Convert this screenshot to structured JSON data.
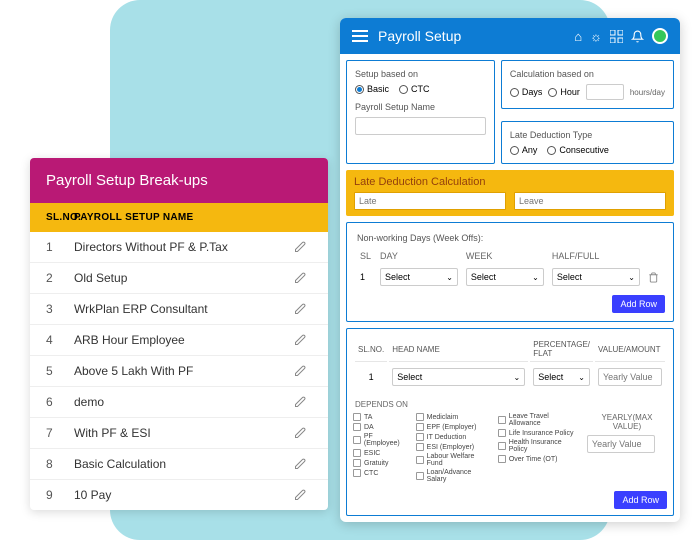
{
  "left": {
    "title": "Payroll Setup Break-ups",
    "cols": {
      "sl": "SL.NO.",
      "name": "PAYROLL SETUP NAME"
    },
    "rows": [
      {
        "n": "1",
        "name": "Directors Without PF & P.Tax"
      },
      {
        "n": "2",
        "name": "Old Setup"
      },
      {
        "n": "3",
        "name": "WrkPlan ERP Consultant"
      },
      {
        "n": "4",
        "name": "ARB Hour Employee"
      },
      {
        "n": "5",
        "name": "Above 5 Lakh With PF"
      },
      {
        "n": "6",
        "name": "demo"
      },
      {
        "n": "7",
        "name": "With PF & ESI"
      },
      {
        "n": "8",
        "name": "Basic Calculation"
      },
      {
        "n": "9",
        "name": "10 Pay"
      }
    ]
  },
  "right": {
    "title": "Payroll Setup",
    "setup": {
      "legend": "Setup based on",
      "opt1": "Basic",
      "opt2": "CTC",
      "name_label": "Payroll Setup Name"
    },
    "calc": {
      "legend": "Calculation based on",
      "opt1": "Days",
      "opt2": "Hour",
      "unit": "hours/day"
    },
    "late_type": {
      "legend": "Late Deduction Type",
      "opt1": "Any",
      "opt2": "Consecutive"
    },
    "late_calc": {
      "title": "Late Deduction Calculation",
      "ph1": "Late",
      "ph2": "Leave"
    },
    "nwd": {
      "title": "Non-working Days (Week Offs):",
      "cols": {
        "sl": "SL",
        "day": "DAY",
        "week": "WEEK",
        "hf": "HALF/FULL"
      },
      "row": {
        "n": "1",
        "sel": "Select"
      },
      "add": "Add Row"
    },
    "heads": {
      "cols": {
        "sl": "SL.NO.",
        "name": "HEAD NAME",
        "pf": "PERCENTAGE/\nFLAT",
        "va": "VALUE/AMOUNT"
      },
      "row": {
        "n": "1",
        "sel": "Select",
        "ph": "Yearly Value"
      }
    },
    "depends": {
      "label": "DEPENDS ON",
      "col1": [
        "TA",
        "DA",
        "PF (Employee)",
        "ESIC",
        "Gratuity",
        "CTC"
      ],
      "col2": [
        "Mediclaim",
        "EPF (Employer)",
        "IT Deduction",
        "ESI (Employer)",
        "Labour Welfare Fund",
        "Loan/Advance Salary"
      ],
      "col3": [
        "Leave Travel Allowance",
        "Life Insurance Policy",
        "Health Insurance Policy",
        "Over Time (OT)"
      ],
      "yearly": {
        "label": "YEARLY(MAX VALUE)",
        "ph": "Yearly Value"
      }
    },
    "add": "Add Row"
  }
}
